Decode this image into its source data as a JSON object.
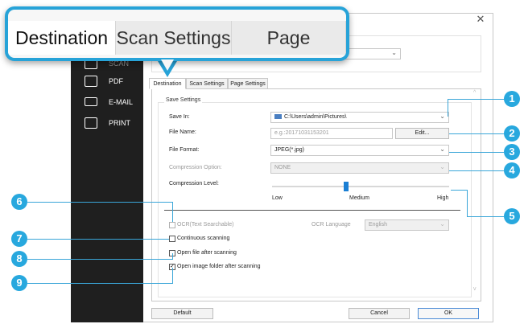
{
  "window": {
    "close_glyph": "✕"
  },
  "sidebar": {
    "items": [
      {
        "label": "SCAN",
        "icon": "scan-icon"
      },
      {
        "label": "PDF",
        "icon": "pdf-icon"
      },
      {
        "label": "E-MAIL",
        "icon": "email-icon"
      },
      {
        "label": "PRINT",
        "icon": "printer-icon"
      }
    ]
  },
  "zoom": {
    "tabs": [
      "Destination",
      "Scan Settings",
      "Page Settings"
    ]
  },
  "tabs": [
    "Destination",
    "Scan Settings",
    "Page Settings"
  ],
  "save_settings": {
    "title": "Save Settings",
    "save_in_label": "Save In:",
    "save_in_value": "C:\\Users\\admin\\Pictures\\",
    "file_name_label": "File Name:",
    "file_name_placeholder": "e.g.:20171031153201",
    "edit_label": "Edit...",
    "file_format_label": "File Format:",
    "file_format_value": "JPEG(*.jpg)",
    "compression_option_label": "Compression Option:",
    "compression_option_value": "NONE",
    "compression_level_label": "Compression Level:",
    "compression_level": {
      "low": "Low",
      "medium": "Medium",
      "high": "High",
      "value": 0.42
    }
  },
  "options": {
    "ocr_label": "OCR(Text Searchable)",
    "ocr_language_label": "OCR Language",
    "ocr_language_value": "English",
    "continuous_label": "Continuous scanning",
    "open_file_label": "Open file after scanning",
    "open_folder_label": "Open image folder after scanning",
    "open_folder_checked": "✓"
  },
  "footer": {
    "default_label": "Default",
    "cancel_label": "Cancel",
    "ok_label": "OK"
  },
  "callouts": [
    "1",
    "2",
    "3",
    "4",
    "5",
    "6",
    "7",
    "8",
    "9"
  ],
  "colors": {
    "accent": "#28a8de",
    "sidebar": "#1f1f1f",
    "slider": "#1a7fd4"
  }
}
